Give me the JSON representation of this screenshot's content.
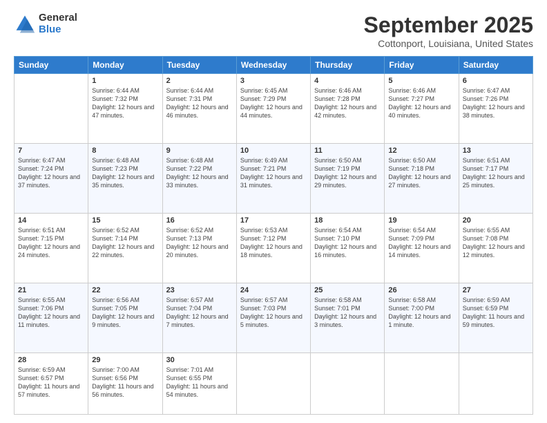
{
  "logo": {
    "general": "General",
    "blue": "Blue"
  },
  "header": {
    "title": "September 2025",
    "subtitle": "Cottonport, Louisiana, United States"
  },
  "days": [
    "Sunday",
    "Monday",
    "Tuesday",
    "Wednesday",
    "Thursday",
    "Friday",
    "Saturday"
  ],
  "weeks": [
    [
      {
        "num": "",
        "sunrise": "",
        "sunset": "",
        "daylight": ""
      },
      {
        "num": "1",
        "sunrise": "Sunrise: 6:44 AM",
        "sunset": "Sunset: 7:32 PM",
        "daylight": "Daylight: 12 hours and 47 minutes."
      },
      {
        "num": "2",
        "sunrise": "Sunrise: 6:44 AM",
        "sunset": "Sunset: 7:31 PM",
        "daylight": "Daylight: 12 hours and 46 minutes."
      },
      {
        "num": "3",
        "sunrise": "Sunrise: 6:45 AM",
        "sunset": "Sunset: 7:29 PM",
        "daylight": "Daylight: 12 hours and 44 minutes."
      },
      {
        "num": "4",
        "sunrise": "Sunrise: 6:46 AM",
        "sunset": "Sunset: 7:28 PM",
        "daylight": "Daylight: 12 hours and 42 minutes."
      },
      {
        "num": "5",
        "sunrise": "Sunrise: 6:46 AM",
        "sunset": "Sunset: 7:27 PM",
        "daylight": "Daylight: 12 hours and 40 minutes."
      },
      {
        "num": "6",
        "sunrise": "Sunrise: 6:47 AM",
        "sunset": "Sunset: 7:26 PM",
        "daylight": "Daylight: 12 hours and 38 minutes."
      }
    ],
    [
      {
        "num": "7",
        "sunrise": "Sunrise: 6:47 AM",
        "sunset": "Sunset: 7:24 PM",
        "daylight": "Daylight: 12 hours and 37 minutes."
      },
      {
        "num": "8",
        "sunrise": "Sunrise: 6:48 AM",
        "sunset": "Sunset: 7:23 PM",
        "daylight": "Daylight: 12 hours and 35 minutes."
      },
      {
        "num": "9",
        "sunrise": "Sunrise: 6:48 AM",
        "sunset": "Sunset: 7:22 PM",
        "daylight": "Daylight: 12 hours and 33 minutes."
      },
      {
        "num": "10",
        "sunrise": "Sunrise: 6:49 AM",
        "sunset": "Sunset: 7:21 PM",
        "daylight": "Daylight: 12 hours and 31 minutes."
      },
      {
        "num": "11",
        "sunrise": "Sunrise: 6:50 AM",
        "sunset": "Sunset: 7:19 PM",
        "daylight": "Daylight: 12 hours and 29 minutes."
      },
      {
        "num": "12",
        "sunrise": "Sunrise: 6:50 AM",
        "sunset": "Sunset: 7:18 PM",
        "daylight": "Daylight: 12 hours and 27 minutes."
      },
      {
        "num": "13",
        "sunrise": "Sunrise: 6:51 AM",
        "sunset": "Sunset: 7:17 PM",
        "daylight": "Daylight: 12 hours and 25 minutes."
      }
    ],
    [
      {
        "num": "14",
        "sunrise": "Sunrise: 6:51 AM",
        "sunset": "Sunset: 7:15 PM",
        "daylight": "Daylight: 12 hours and 24 minutes."
      },
      {
        "num": "15",
        "sunrise": "Sunrise: 6:52 AM",
        "sunset": "Sunset: 7:14 PM",
        "daylight": "Daylight: 12 hours and 22 minutes."
      },
      {
        "num": "16",
        "sunrise": "Sunrise: 6:52 AM",
        "sunset": "Sunset: 7:13 PM",
        "daylight": "Daylight: 12 hours and 20 minutes."
      },
      {
        "num": "17",
        "sunrise": "Sunrise: 6:53 AM",
        "sunset": "Sunset: 7:12 PM",
        "daylight": "Daylight: 12 hours and 18 minutes."
      },
      {
        "num": "18",
        "sunrise": "Sunrise: 6:54 AM",
        "sunset": "Sunset: 7:10 PM",
        "daylight": "Daylight: 12 hours and 16 minutes."
      },
      {
        "num": "19",
        "sunrise": "Sunrise: 6:54 AM",
        "sunset": "Sunset: 7:09 PM",
        "daylight": "Daylight: 12 hours and 14 minutes."
      },
      {
        "num": "20",
        "sunrise": "Sunrise: 6:55 AM",
        "sunset": "Sunset: 7:08 PM",
        "daylight": "Daylight: 12 hours and 12 minutes."
      }
    ],
    [
      {
        "num": "21",
        "sunrise": "Sunrise: 6:55 AM",
        "sunset": "Sunset: 7:06 PM",
        "daylight": "Daylight: 12 hours and 11 minutes."
      },
      {
        "num": "22",
        "sunrise": "Sunrise: 6:56 AM",
        "sunset": "Sunset: 7:05 PM",
        "daylight": "Daylight: 12 hours and 9 minutes."
      },
      {
        "num": "23",
        "sunrise": "Sunrise: 6:57 AM",
        "sunset": "Sunset: 7:04 PM",
        "daylight": "Daylight: 12 hours and 7 minutes."
      },
      {
        "num": "24",
        "sunrise": "Sunrise: 6:57 AM",
        "sunset": "Sunset: 7:03 PM",
        "daylight": "Daylight: 12 hours and 5 minutes."
      },
      {
        "num": "25",
        "sunrise": "Sunrise: 6:58 AM",
        "sunset": "Sunset: 7:01 PM",
        "daylight": "Daylight: 12 hours and 3 minutes."
      },
      {
        "num": "26",
        "sunrise": "Sunrise: 6:58 AM",
        "sunset": "Sunset: 7:00 PM",
        "daylight": "Daylight: 12 hours and 1 minute."
      },
      {
        "num": "27",
        "sunrise": "Sunrise: 6:59 AM",
        "sunset": "Sunset: 6:59 PM",
        "daylight": "Daylight: 11 hours and 59 minutes."
      }
    ],
    [
      {
        "num": "28",
        "sunrise": "Sunrise: 6:59 AM",
        "sunset": "Sunset: 6:57 PM",
        "daylight": "Daylight: 11 hours and 57 minutes."
      },
      {
        "num": "29",
        "sunrise": "Sunrise: 7:00 AM",
        "sunset": "Sunset: 6:56 PM",
        "daylight": "Daylight: 11 hours and 56 minutes."
      },
      {
        "num": "30",
        "sunrise": "Sunrise: 7:01 AM",
        "sunset": "Sunset: 6:55 PM",
        "daylight": "Daylight: 11 hours and 54 minutes."
      },
      {
        "num": "",
        "sunrise": "",
        "sunset": "",
        "daylight": ""
      },
      {
        "num": "",
        "sunrise": "",
        "sunset": "",
        "daylight": ""
      },
      {
        "num": "",
        "sunrise": "",
        "sunset": "",
        "daylight": ""
      },
      {
        "num": "",
        "sunrise": "",
        "sunset": "",
        "daylight": ""
      }
    ]
  ]
}
